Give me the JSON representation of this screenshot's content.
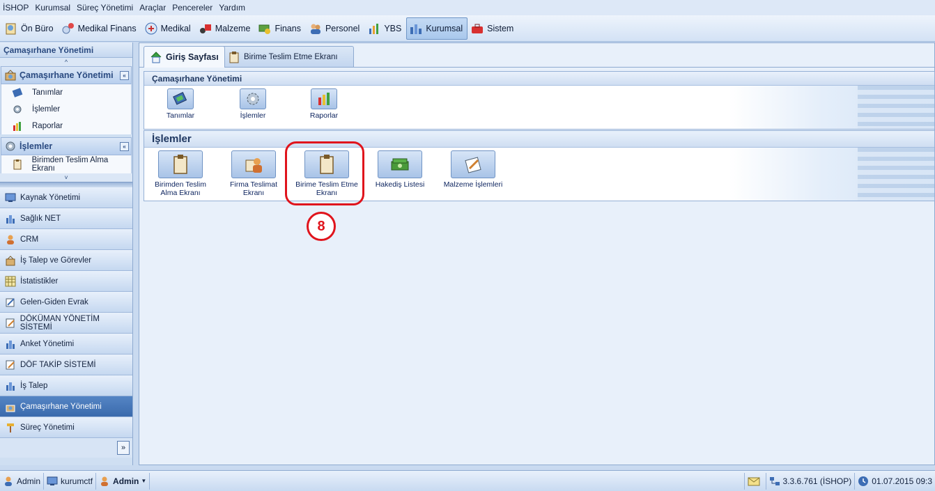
{
  "menu": {
    "items": [
      "İSHOP",
      "Kurumsal",
      "Süreç Yönetimi",
      "Araçlar",
      "Pencereler",
      "Yardım"
    ]
  },
  "modules": [
    {
      "label": "Ön Büro",
      "icon": "front-office-icon"
    },
    {
      "label": "Medikal Finans",
      "icon": "medical-finance-icon"
    },
    {
      "label": "Medikal",
      "icon": "medical-icon"
    },
    {
      "label": "Malzeme",
      "icon": "material-icon"
    },
    {
      "label": "Finans",
      "icon": "finance-icon"
    },
    {
      "label": "Personel",
      "icon": "personnel-icon"
    },
    {
      "label": "YBS",
      "icon": "ybs-chart-icon"
    },
    {
      "label": "Kurumsal",
      "icon": "corporate-icon",
      "active": true
    },
    {
      "label": "Sistem",
      "icon": "system-toolbox-icon"
    }
  ],
  "sidebar": {
    "title": "Çamaşırhane Yönetimi",
    "scroll_up": "^",
    "scroll_down": "˅",
    "group1": {
      "title": "Çamaşırhane Yönetimi",
      "collapse": "«",
      "items": [
        "Tanımlar",
        "İşlemler",
        "Raporlar"
      ]
    },
    "group2": {
      "title": "İşlemler",
      "collapse": "«",
      "items": [
        "Birimden Teslim Alma Ekranı"
      ]
    },
    "nav": [
      {
        "label": "Kaynak Yönetimi"
      },
      {
        "label": "Sağlık NET"
      },
      {
        "label": "CRM"
      },
      {
        "label": "İş Talep ve Görevler"
      },
      {
        "label": "İstatistikler"
      },
      {
        "label": "Gelen-Giden Evrak"
      },
      {
        "label": "DÖKÜMAN YÖNETİM SİSTEMİ"
      },
      {
        "label": "Anket Yönetimi"
      },
      {
        "label": "DÖF TAKİP SİSTEMİ"
      },
      {
        "label": "İş Talep"
      },
      {
        "label": "Çamaşırhane Yönetimi",
        "active": true
      },
      {
        "label": "Süreç Yönetimi"
      }
    ],
    "expand": "»"
  },
  "tabs": {
    "home": "Giriş Sayfası",
    "other": "Birime Teslim Etme Ekranı"
  },
  "panel1": {
    "title": "Çamaşırhane Yönetimi",
    "tiles": [
      "Tanımlar",
      "İşlemler",
      "Raporlar"
    ]
  },
  "panel2": {
    "title": "İşlemler",
    "tiles": [
      [
        "Birimden Teslim",
        "Alma Ekranı"
      ],
      [
        "Firma Teslimat",
        "Ekranı"
      ],
      [
        "Birime Teslim Etme",
        "Ekranı"
      ],
      [
        "Hakediş Listesi",
        ""
      ],
      [
        "Malzeme İşlemleri",
        ""
      ]
    ]
  },
  "annotation": {
    "number": "8",
    "color": "#e0141c"
  },
  "status": {
    "user": "Admin",
    "machine": "kurumctf",
    "role": "Admin",
    "version": "3.3.6.761 (İSHOP)",
    "datetime": "01.07.2015 09:3"
  }
}
